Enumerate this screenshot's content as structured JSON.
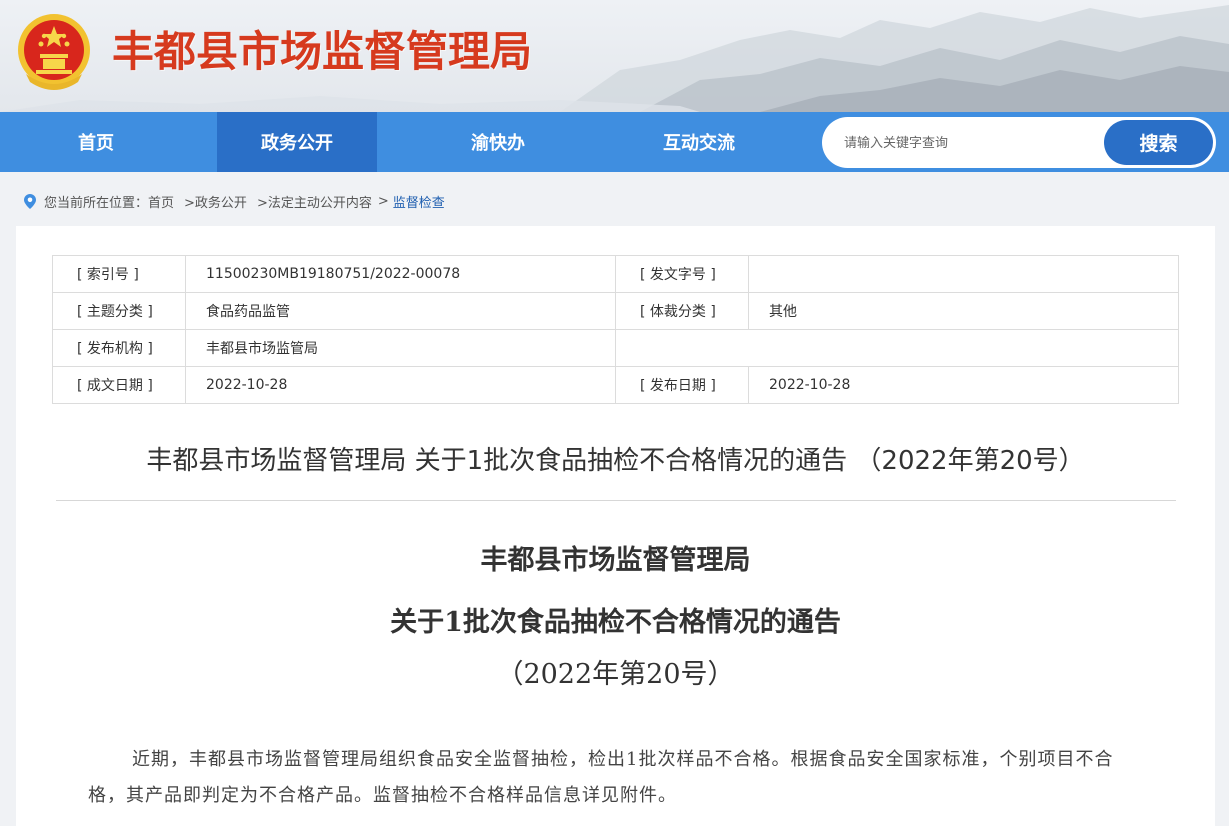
{
  "header": {
    "site_title": "丰都县市场监督管理局",
    "emblem_icon": "national-emblem-icon"
  },
  "nav": {
    "items": [
      {
        "label": "首页",
        "active": false
      },
      {
        "label": "政务公开",
        "active": true
      },
      {
        "label": "渝快办",
        "active": false
      },
      {
        "label": "互动交流",
        "active": false
      }
    ],
    "search": {
      "placeholder": "请输入关键字查询",
      "button_label": "搜索"
    }
  },
  "breadcrumb": {
    "icon": "location-pin-icon",
    "prefix": "您当前所在位置：",
    "items": [
      "首页",
      ">政务公开",
      ">法定主动公开内容",
      ">",
      "监督检查"
    ]
  },
  "meta": {
    "rows": [
      {
        "k1": "[ 索引号 ]",
        "v1": "11500230MB19180751/2022-00078",
        "k2": "[ 发文字号 ]",
        "v2": ""
      },
      {
        "k1": "[ 主题分类 ]",
        "v1": "食品药品监管",
        "k2": "[ 体裁分类 ]",
        "v2": "其他"
      },
      {
        "k1": "[ 发布机构 ]",
        "v1": "丰都县市场监管局",
        "k2": "",
        "v2": ""
      },
      {
        "k1": "[ 成文日期 ]",
        "v1": "2022-10-28",
        "k2": "[ 发布日期 ]",
        "v2": "2022-10-28"
      }
    ]
  },
  "document": {
    "title": "丰都县市场监督管理局 关于1批次食品抽检不合格情况的通告 （2022年第20号）",
    "heading_line1": "丰都县市场监督管理局",
    "heading_line2": "关于1批次食品抽检不合格情况的通告",
    "heading_line3": "（2022年第20号）",
    "paragraph1": "近期，丰都县市场监督管理局组织食品安全监督抽检，检出1批次样品不合格。根据食品安全国家标准，个别项目不合格，其产品即判定为不合格产品。监督抽检不合格样品信息详见附件。"
  },
  "colors": {
    "title_red": "#d63a1e",
    "nav_blue": "#3f8ee0",
    "nav_active": "#2a6fc7"
  }
}
